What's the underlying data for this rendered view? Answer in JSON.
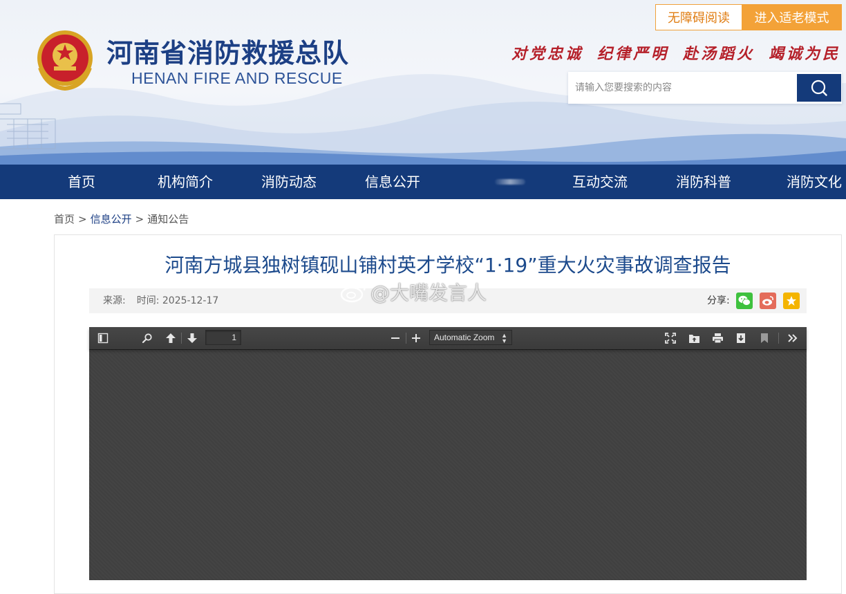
{
  "header": {
    "title": "河南省消防救援总队",
    "subtitle": "HENAN FIRE AND RESCUE",
    "accessible_button": "无障碍阅读",
    "elder_mode_button": "进入适老模式",
    "slogans": [
      "对党忠诚",
      "纪律严明",
      "赴汤蹈火",
      "竭诚为民"
    ],
    "search": {
      "placeholder": "请输入您要搜索的内容"
    }
  },
  "nav": {
    "items": [
      "首页",
      "机构简介",
      "消防动态",
      "信息公开",
      "互动交流",
      "消防科普",
      "消防文化"
    ]
  },
  "breadcrumb": {
    "items": [
      "首页",
      "信息公开",
      "通知公告"
    ],
    "separator": ">"
  },
  "article": {
    "title": "河南方城县独树镇砚山铺村英才学校“1·19”重大火灾事故调查报告",
    "source_label": "来源:",
    "time_label": "时间:",
    "time_value": "2025-12-17",
    "share_label": "分享:"
  },
  "watermark": "@大嘴发言人",
  "pdf_viewer": {
    "page_number": "1",
    "zoom": "Automatic Zoom"
  },
  "colors": {
    "brand_blue": "#143a7a",
    "title_blue": "#1c4a8c",
    "accent_orange": "#f3a238",
    "slogan_red": "#b5202a",
    "wechat_green": "#3ec13e",
    "weibo_red": "#e46c5a",
    "qzone_yellow": "#f4b400"
  },
  "icons": {
    "search": "search-icon",
    "share": [
      "wechat-icon",
      "weibo-icon",
      "qzone-star-icon"
    ],
    "toolbar": [
      "sidebar-toggle-icon",
      "find-icon",
      "previous-page-icon",
      "next-page-icon",
      "zoom-out-icon",
      "zoom-in-icon",
      "presentation-mode-icon",
      "open-file-icon",
      "print-icon",
      "download-icon",
      "bookmark-icon",
      "tools-icon"
    ]
  }
}
